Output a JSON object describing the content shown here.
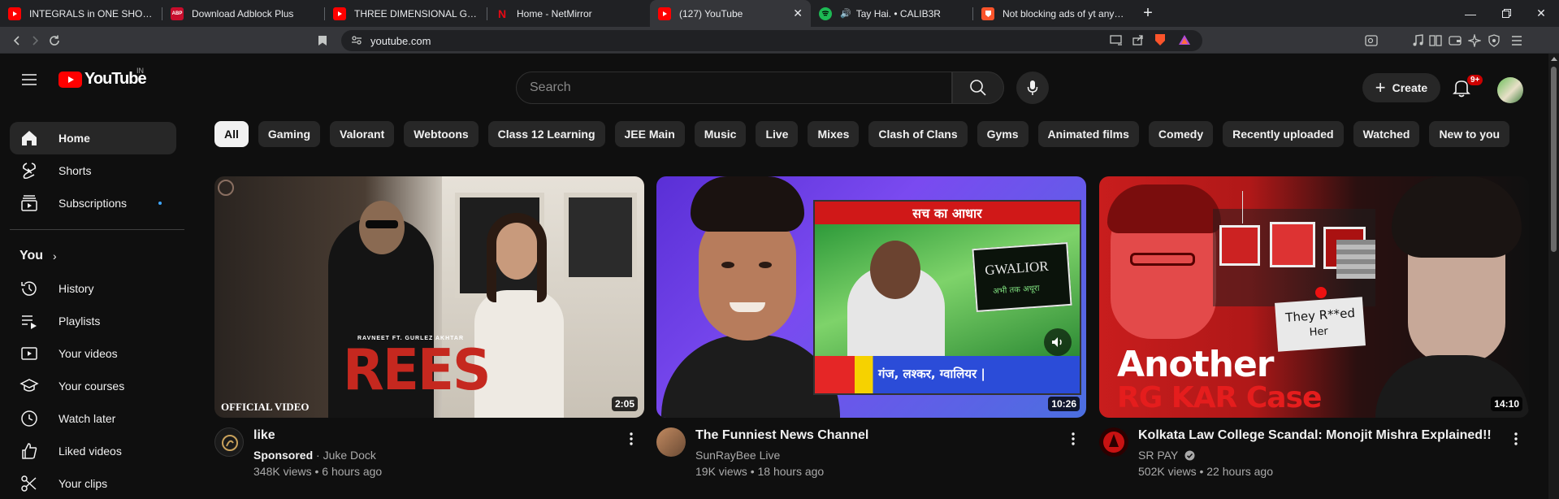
{
  "browser": {
    "tabs": [
      {
        "title": "INTEGRALS in ONE SHOT || Full Chap",
        "favicon": "youtube-favicon",
        "color": "#ff0000"
      },
      {
        "title": "Download Adblock Plus",
        "favicon": "abp-favicon",
        "favicon_text": "ABP",
        "color": "#c70d2c"
      },
      {
        "title": "THREE DIMENSIONAL GEOMETRY in",
        "favicon": "youtube-favicon",
        "color": "#ff0000"
      },
      {
        "title": "Home - NetMirror",
        "favicon": "netmirror-favicon",
        "favicon_text": "N",
        "color": "#e50914"
      },
      {
        "title": "(127) YouTube",
        "favicon": "youtube-favicon",
        "color": "#ff0000",
        "active": true
      },
      {
        "title": "Tay Hai. • CALIB3R",
        "favicon": "spotify-favicon",
        "color": "#1db954",
        "audio": true
      },
      {
        "title": "Not blocking ads of yt anymore :( - B",
        "favicon": "brave-favicon",
        "color": "#fb542b"
      }
    ],
    "url": "youtube.com"
  },
  "header": {
    "logo_text": "YouTube",
    "region": "IN",
    "search_placeholder": "Search",
    "create_label": "Create",
    "notification_count": "9+"
  },
  "sidebar": {
    "main": [
      {
        "label": "Home",
        "icon": "home-icon",
        "active": true
      },
      {
        "label": "Shorts",
        "icon": "shorts-icon"
      },
      {
        "label": "Subscriptions",
        "icon": "subscriptions-icon",
        "dot": true
      }
    ],
    "you_label": "You",
    "you_items": [
      {
        "label": "History",
        "icon": "history-icon"
      },
      {
        "label": "Playlists",
        "icon": "playlists-icon"
      },
      {
        "label": "Your videos",
        "icon": "your-videos-icon"
      },
      {
        "label": "Your courses",
        "icon": "courses-icon"
      },
      {
        "label": "Watch later",
        "icon": "watch-later-icon"
      },
      {
        "label": "Liked videos",
        "icon": "liked-icon"
      },
      {
        "label": "Your clips",
        "icon": "clips-icon"
      }
    ]
  },
  "chips": [
    "All",
    "Gaming",
    "Valorant",
    "Webtoons",
    "Class 12 Learning",
    "JEE Main",
    "Music",
    "Live",
    "Mixes",
    "Clash of Clans",
    "Gyms",
    "Animated films",
    "Comedy",
    "Recently uploaded",
    "Watched",
    "New to you"
  ],
  "videos": [
    {
      "title": "like",
      "sponsored": "Sponsored",
      "channel": "Juke Dock",
      "stats": "348K views • 6 hours ago",
      "duration": "2:05",
      "thumb_text_big": "REES",
      "thumb_text_small": "RAVNEET FT. GURLEZ AKHTAR",
      "thumb_text_corner": "OFFICIAL VIDEO"
    },
    {
      "title": "The Funniest News Channel",
      "channel": "SunRayBee Live",
      "stats": "19K views • 18 hours ago",
      "duration": "10:26",
      "thumb_banner": "सच का आधार",
      "thumb_board": "GWALIOR",
      "thumb_board_sub": "अभी तक अधूरा",
      "thumb_ticker": "गंज, लश्कर, ग्वालियर |"
    },
    {
      "title": "Kolkata Law College Scandal: Monojit Mishra Explained!!",
      "channel": "SR PAY",
      "verified": true,
      "stats": "502K views • 22 hours ago",
      "duration": "14:10",
      "thumb_line1": "Another",
      "thumb_line2": "RG KAR Case",
      "thumb_note1": "They R**ed",
      "thumb_note2": "Her"
    }
  ]
}
